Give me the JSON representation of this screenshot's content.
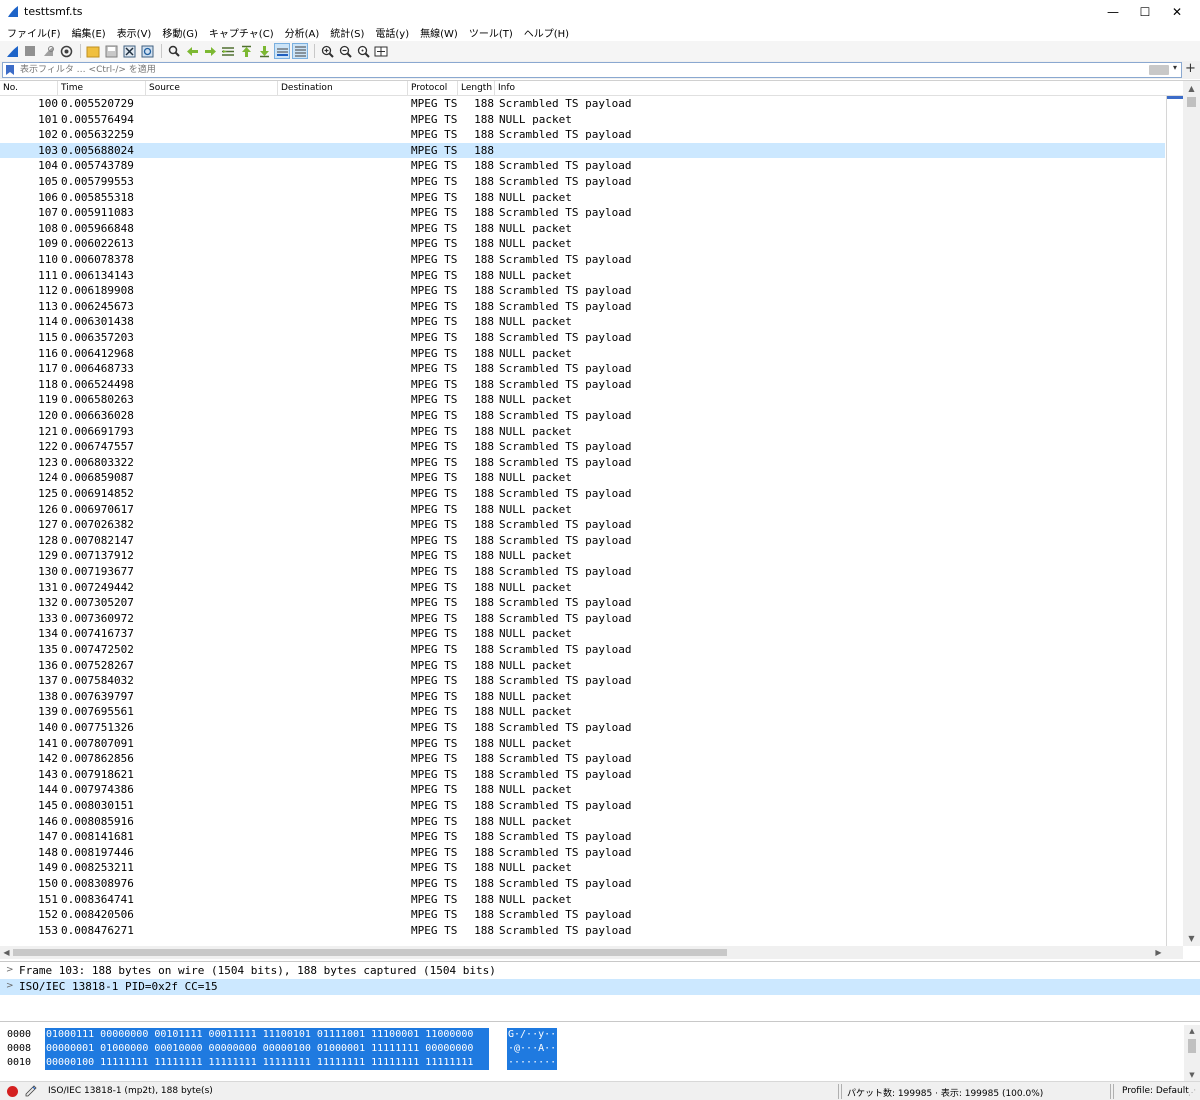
{
  "window": {
    "title": "testtsmf.ts",
    "minimize_glyph": "—",
    "maximize_glyph": "☐",
    "close_glyph": "✕"
  },
  "menu": [
    {
      "label": "ファイル(F)"
    },
    {
      "label": "編集(E)"
    },
    {
      "label": "表示(V)"
    },
    {
      "label": "移動(G)"
    },
    {
      "label": "キャプチャ(C)"
    },
    {
      "label": "分析(A)"
    },
    {
      "label": "統計(S)"
    },
    {
      "label": "電話(y)"
    },
    {
      "label": "無線(W)"
    },
    {
      "label": "ツール(T)"
    },
    {
      "label": "ヘルプ(H)"
    }
  ],
  "toolbar": {
    "icons": [
      "shark-fin-start-icon",
      "stop-icon",
      "restart-icon",
      "capture-options-icon",
      "open-folder-icon",
      "save-icon",
      "close-file-icon",
      "reload-icon",
      "find-icon",
      "back-arrow-icon",
      "forward-arrow-icon",
      "go-to-packet-icon",
      "first-packet-icon",
      "last-packet-icon",
      "auto-scroll-icon",
      "colorize-icon",
      "zoom-in-icon",
      "zoom-out-icon",
      "zoom-normal-icon",
      "resize-columns-icon"
    ]
  },
  "filter": {
    "placeholder": "表示フィルタ … <Ctrl-/> を適用",
    "dropdown_glyph": "▾",
    "add_glyph": "+"
  },
  "columns": [
    {
      "label": "No."
    },
    {
      "label": "Time"
    },
    {
      "label": "Source"
    },
    {
      "label": "Destination"
    },
    {
      "label": "Protocol"
    },
    {
      "label": "Length"
    },
    {
      "label": "Info"
    }
  ],
  "packets": [
    {
      "no": "100",
      "time": "0.005520729",
      "protocol": "MPEG TS",
      "length": "188",
      "info": "Scrambled TS payload"
    },
    {
      "no": "101",
      "time": "0.005576494",
      "protocol": "MPEG TS",
      "length": "188",
      "info": "NULL packet"
    },
    {
      "no": "102",
      "time": "0.005632259",
      "protocol": "MPEG TS",
      "length": "188",
      "info": "Scrambled TS payload"
    },
    {
      "no": "103",
      "time": "0.005688024",
      "protocol": "MPEG TS",
      "length": "188",
      "info": "",
      "selected": true
    },
    {
      "no": "104",
      "time": "0.005743789",
      "protocol": "MPEG TS",
      "length": "188",
      "info": "Scrambled TS payload"
    },
    {
      "no": "105",
      "time": "0.005799553",
      "protocol": "MPEG TS",
      "length": "188",
      "info": "Scrambled TS payload"
    },
    {
      "no": "106",
      "time": "0.005855318",
      "protocol": "MPEG TS",
      "length": "188",
      "info": "NULL packet"
    },
    {
      "no": "107",
      "time": "0.005911083",
      "protocol": "MPEG TS",
      "length": "188",
      "info": "Scrambled TS payload"
    },
    {
      "no": "108",
      "time": "0.005966848",
      "protocol": "MPEG TS",
      "length": "188",
      "info": "NULL packet"
    },
    {
      "no": "109",
      "time": "0.006022613",
      "protocol": "MPEG TS",
      "length": "188",
      "info": "NULL packet"
    },
    {
      "no": "110",
      "time": "0.006078378",
      "protocol": "MPEG TS",
      "length": "188",
      "info": "Scrambled TS payload"
    },
    {
      "no": "111",
      "time": "0.006134143",
      "protocol": "MPEG TS",
      "length": "188",
      "info": "NULL packet"
    },
    {
      "no": "112",
      "time": "0.006189908",
      "protocol": "MPEG TS",
      "length": "188",
      "info": "Scrambled TS payload"
    },
    {
      "no": "113",
      "time": "0.006245673",
      "protocol": "MPEG TS",
      "length": "188",
      "info": "Scrambled TS payload"
    },
    {
      "no": "114",
      "time": "0.006301438",
      "protocol": "MPEG TS",
      "length": "188",
      "info": "NULL packet"
    },
    {
      "no": "115",
      "time": "0.006357203",
      "protocol": "MPEG TS",
      "length": "188",
      "info": "Scrambled TS payload"
    },
    {
      "no": "116",
      "time": "0.006412968",
      "protocol": "MPEG TS",
      "length": "188",
      "info": "NULL packet"
    },
    {
      "no": "117",
      "time": "0.006468733",
      "protocol": "MPEG TS",
      "length": "188",
      "info": "Scrambled TS payload"
    },
    {
      "no": "118",
      "time": "0.006524498",
      "protocol": "MPEG TS",
      "length": "188",
      "info": "Scrambled TS payload"
    },
    {
      "no": "119",
      "time": "0.006580263",
      "protocol": "MPEG TS",
      "length": "188",
      "info": "NULL packet"
    },
    {
      "no": "120",
      "time": "0.006636028",
      "protocol": "MPEG TS",
      "length": "188",
      "info": "Scrambled TS payload"
    },
    {
      "no": "121",
      "time": "0.006691793",
      "protocol": "MPEG TS",
      "length": "188",
      "info": "NULL packet"
    },
    {
      "no": "122",
      "time": "0.006747557",
      "protocol": "MPEG TS",
      "length": "188",
      "info": "Scrambled TS payload"
    },
    {
      "no": "123",
      "time": "0.006803322",
      "protocol": "MPEG TS",
      "length": "188",
      "info": "Scrambled TS payload"
    },
    {
      "no": "124",
      "time": "0.006859087",
      "protocol": "MPEG TS",
      "length": "188",
      "info": "NULL packet"
    },
    {
      "no": "125",
      "time": "0.006914852",
      "protocol": "MPEG TS",
      "length": "188",
      "info": "Scrambled TS payload"
    },
    {
      "no": "126",
      "time": "0.006970617",
      "protocol": "MPEG TS",
      "length": "188",
      "info": "NULL packet"
    },
    {
      "no": "127",
      "time": "0.007026382",
      "protocol": "MPEG TS",
      "length": "188",
      "info": "Scrambled TS payload"
    },
    {
      "no": "128",
      "time": "0.007082147",
      "protocol": "MPEG TS",
      "length": "188",
      "info": "Scrambled TS payload"
    },
    {
      "no": "129",
      "time": "0.007137912",
      "protocol": "MPEG TS",
      "length": "188",
      "info": "NULL packet"
    },
    {
      "no": "130",
      "time": "0.007193677",
      "protocol": "MPEG TS",
      "length": "188",
      "info": "Scrambled TS payload"
    },
    {
      "no": "131",
      "time": "0.007249442",
      "protocol": "MPEG TS",
      "length": "188",
      "info": "NULL packet"
    },
    {
      "no": "132",
      "time": "0.007305207",
      "protocol": "MPEG TS",
      "length": "188",
      "info": "Scrambled TS payload"
    },
    {
      "no": "133",
      "time": "0.007360972",
      "protocol": "MPEG TS",
      "length": "188",
      "info": "Scrambled TS payload"
    },
    {
      "no": "134",
      "time": "0.007416737",
      "protocol": "MPEG TS",
      "length": "188",
      "info": "NULL packet"
    },
    {
      "no": "135",
      "time": "0.007472502",
      "protocol": "MPEG TS",
      "length": "188",
      "info": "Scrambled TS payload"
    },
    {
      "no": "136",
      "time": "0.007528267",
      "protocol": "MPEG TS",
      "length": "188",
      "info": "NULL packet"
    },
    {
      "no": "137",
      "time": "0.007584032",
      "protocol": "MPEG TS",
      "length": "188",
      "info": "Scrambled TS payload"
    },
    {
      "no": "138",
      "time": "0.007639797",
      "protocol": "MPEG TS",
      "length": "188",
      "info": "NULL packet"
    },
    {
      "no": "139",
      "time": "0.007695561",
      "protocol": "MPEG TS",
      "length": "188",
      "info": "NULL packet"
    },
    {
      "no": "140",
      "time": "0.007751326",
      "protocol": "MPEG TS",
      "length": "188",
      "info": "Scrambled TS payload"
    },
    {
      "no": "141",
      "time": "0.007807091",
      "protocol": "MPEG TS",
      "length": "188",
      "info": "NULL packet"
    },
    {
      "no": "142",
      "time": "0.007862856",
      "protocol": "MPEG TS",
      "length": "188",
      "info": "Scrambled TS payload"
    },
    {
      "no": "143",
      "time": "0.007918621",
      "protocol": "MPEG TS",
      "length": "188",
      "info": "Scrambled TS payload"
    },
    {
      "no": "144",
      "time": "0.007974386",
      "protocol": "MPEG TS",
      "length": "188",
      "info": "NULL packet"
    },
    {
      "no": "145",
      "time": "0.008030151",
      "protocol": "MPEG TS",
      "length": "188",
      "info": "Scrambled TS payload"
    },
    {
      "no": "146",
      "time": "0.008085916",
      "protocol": "MPEG TS",
      "length": "188",
      "info": "NULL packet"
    },
    {
      "no": "147",
      "time": "0.008141681",
      "protocol": "MPEG TS",
      "length": "188",
      "info": "Scrambled TS payload"
    },
    {
      "no": "148",
      "time": "0.008197446",
      "protocol": "MPEG TS",
      "length": "188",
      "info": "Scrambled TS payload"
    },
    {
      "no": "149",
      "time": "0.008253211",
      "protocol": "MPEG TS",
      "length": "188",
      "info": "NULL packet"
    },
    {
      "no": "150",
      "time": "0.008308976",
      "protocol": "MPEG TS",
      "length": "188",
      "info": "Scrambled TS payload"
    },
    {
      "no": "151",
      "time": "0.008364741",
      "protocol": "MPEG TS",
      "length": "188",
      "info": "NULL packet"
    },
    {
      "no": "152",
      "time": "0.008420506",
      "protocol": "MPEG TS",
      "length": "188",
      "info": "Scrambled TS payload"
    },
    {
      "no": "153",
      "time": "0.008476271",
      "protocol": "MPEG TS",
      "length": "188",
      "info": "Scrambled TS payload"
    }
  ],
  "details": [
    {
      "text": "Frame 103: 188 bytes on wire (1504 bits), 188 bytes captured (1504 bits)",
      "selected": false
    },
    {
      "text": "ISO/IEC 13818-1 PID=0x2f CC=15",
      "selected": true
    }
  ],
  "bytes": [
    {
      "offset": "0000",
      "bits": "01000111 00000000 00101111 00011111 11100101 01111001 11100001 11000000",
      "ascii": "G·/··y··"
    },
    {
      "offset": "0008",
      "bits": "00000001 01000000 00010000 00000000 00000100 01000001 11111111 00000000",
      "ascii": "·@···A··"
    },
    {
      "offset": "0010",
      "bits": "00000100 11111111 11111111 11111111 11111111 11111111 11111111 11111111",
      "ascii": "········"
    }
  ],
  "status": {
    "protocol_info": "ISO/IEC 13818-1 (mp2t), 188 byte(s)",
    "counts": "パケット数: 199985 · 表示: 199985 (100.0%)",
    "profile": "Profile: Default"
  },
  "colors": {
    "selection": "#cce8ff",
    "bytes_highlight": "#1f7ae0",
    "accent": "#3c6cc8"
  }
}
